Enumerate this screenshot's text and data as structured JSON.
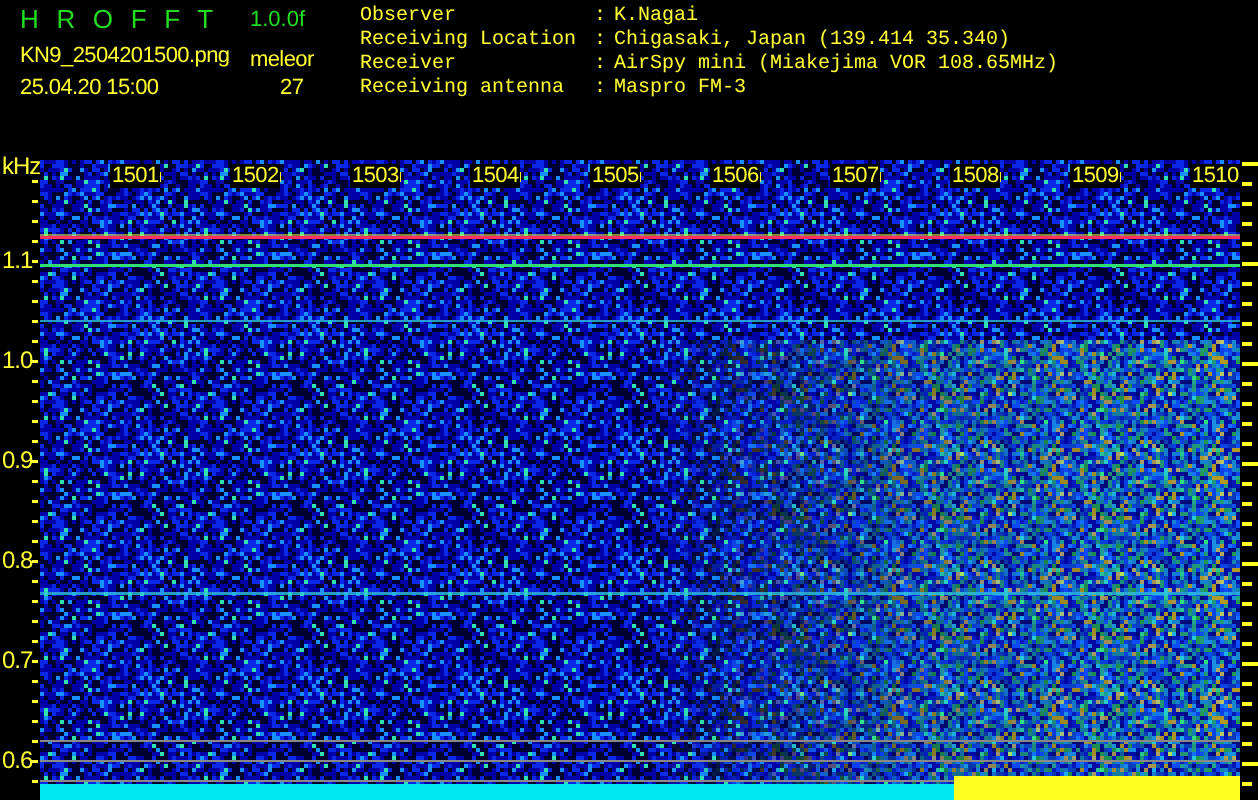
{
  "app": {
    "title": "H R O F F T",
    "version": "1.0.0f",
    "filename": "KN9_2504201500.png",
    "mode_label": "meleor",
    "timestamp": "25.04.20 15:00",
    "count": "27"
  },
  "info": [
    {
      "label": "Observer",
      "separator": ":",
      "value": "K.Nagai"
    },
    {
      "label": "Receiving Location",
      "separator": ":",
      "value": "Chigasaki, Japan (139.414 35.340)"
    },
    {
      "label": "Receiver",
      "separator": ":",
      "value": "AirSpy mini (Miakejima VOR 108.65MHz)"
    },
    {
      "label": "Receiving antenna",
      "separator": ":",
      "value": "Maspro FM-3"
    }
  ],
  "spectrogram": {
    "y_unit": "kHz",
    "y_ticks": [
      "1.1",
      "1.0",
      "0.9",
      "0.8",
      "0.7",
      "0.6"
    ],
    "time_labels": [
      "1501",
      "1502",
      "1503",
      "1504",
      "1505",
      "1506",
      "1507",
      "1508",
      "1509",
      "1510"
    ]
  }
}
